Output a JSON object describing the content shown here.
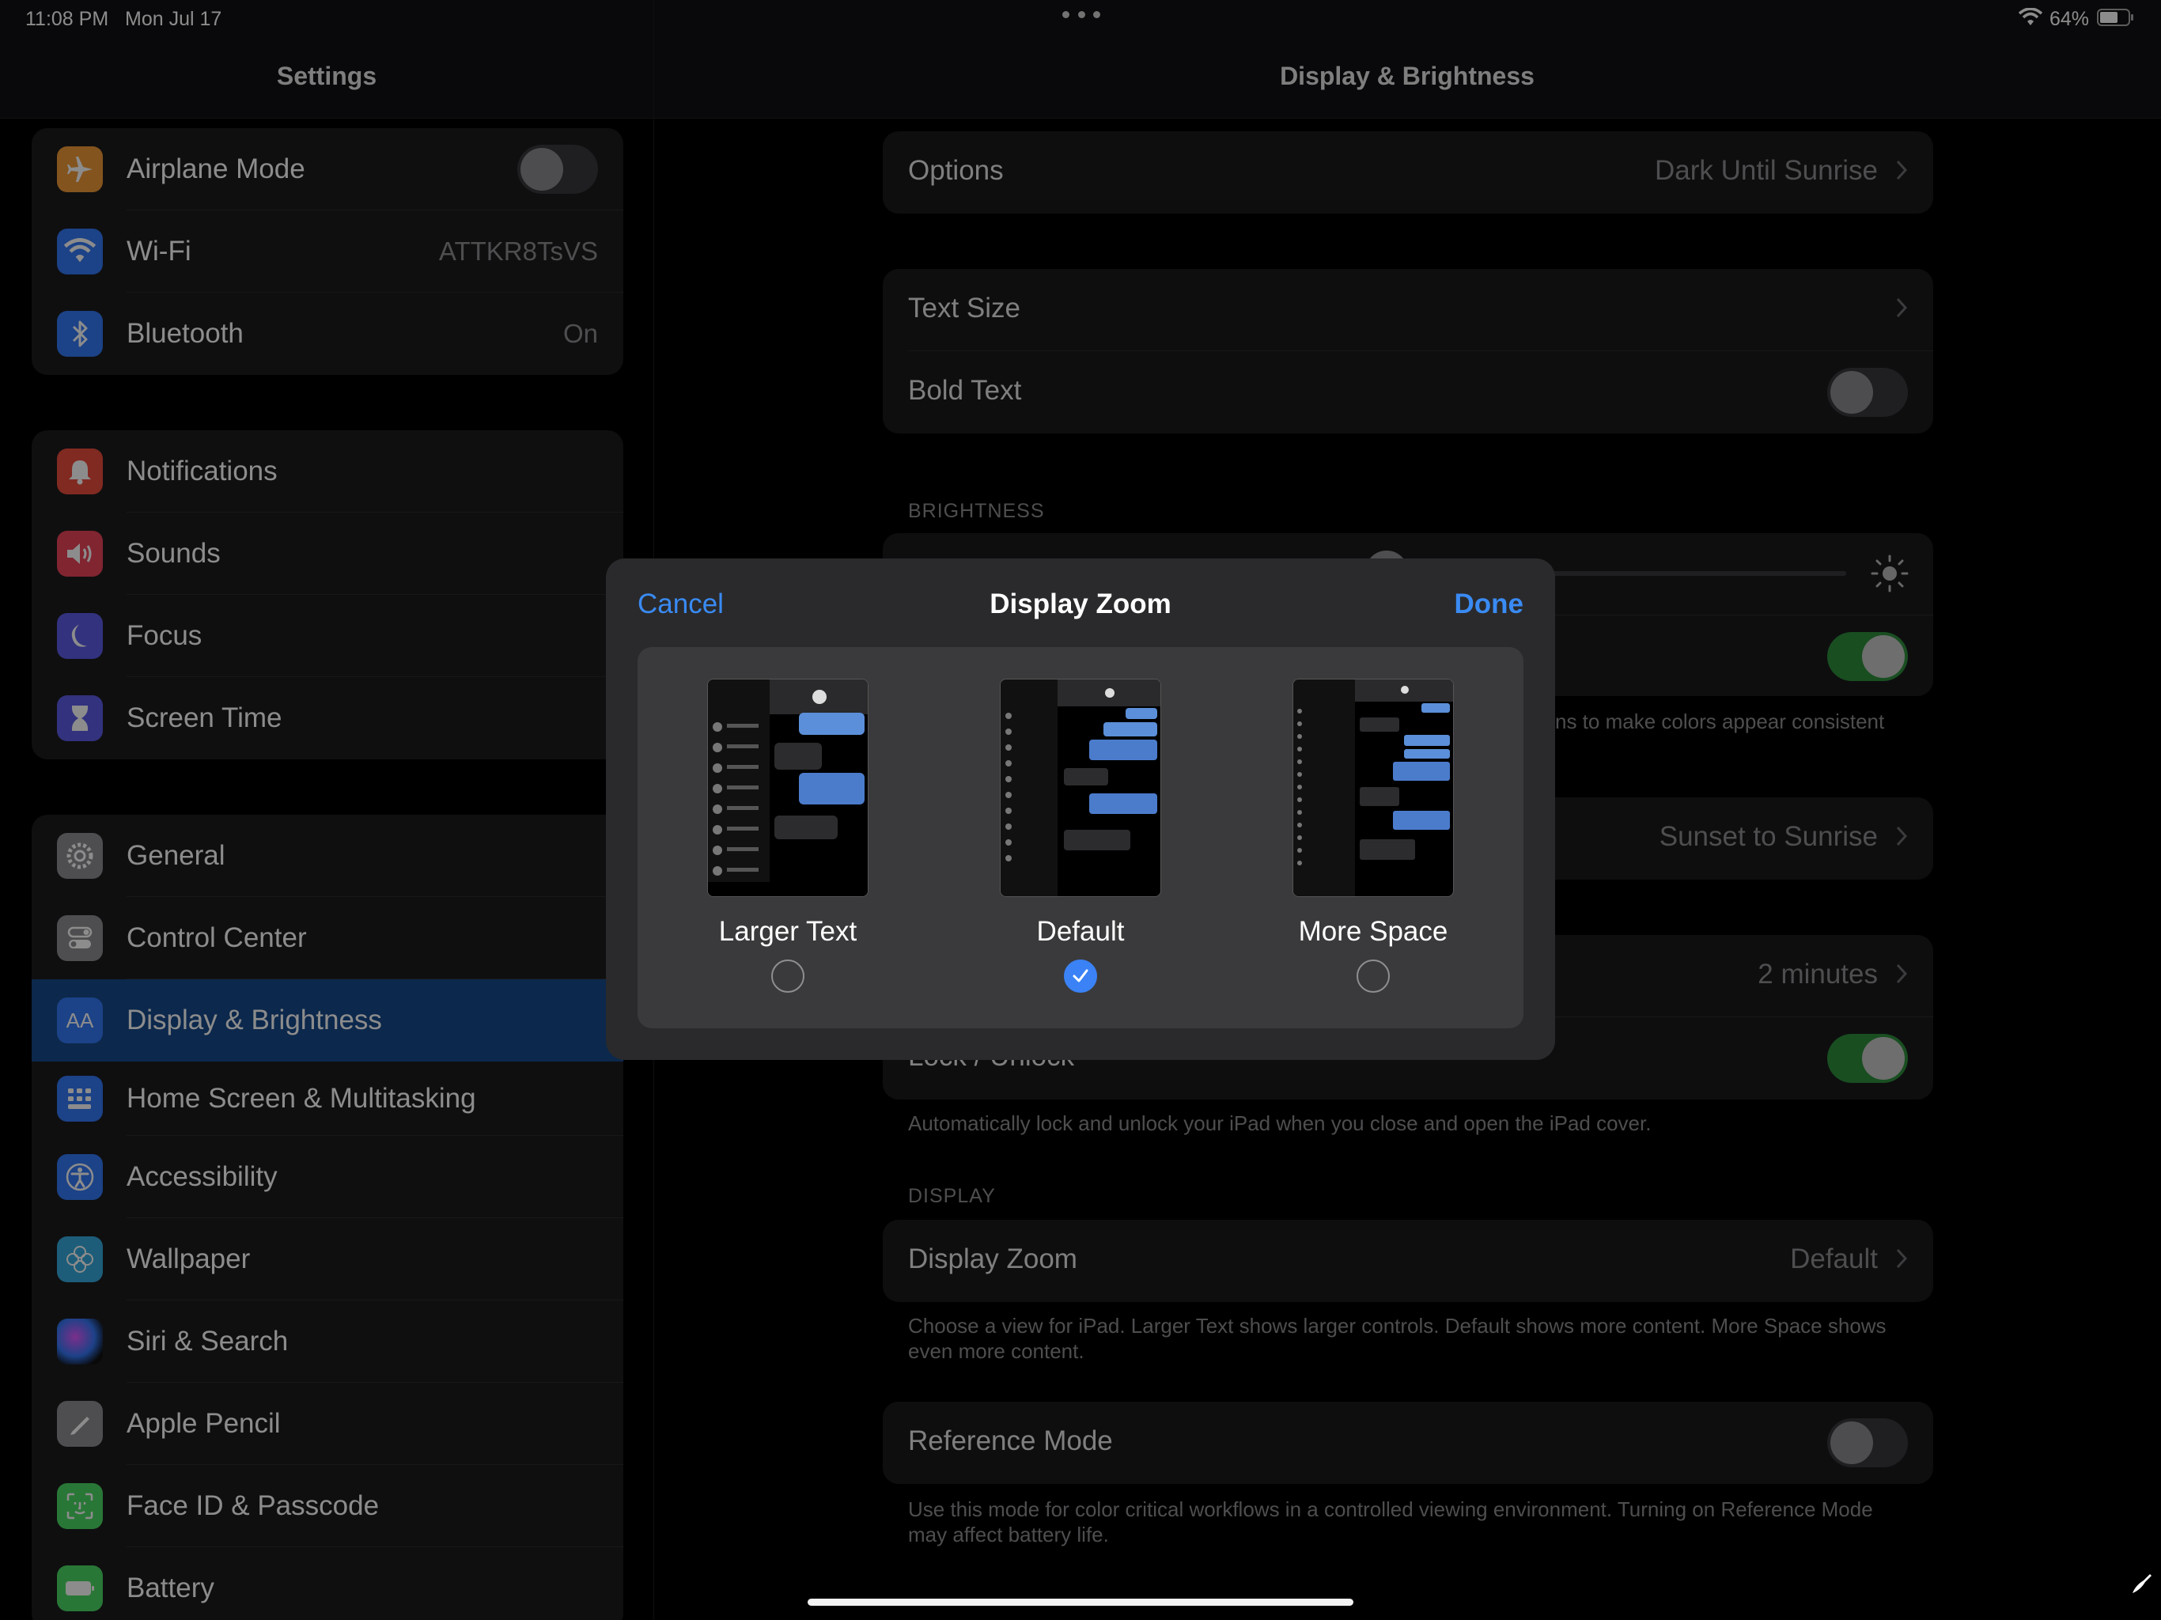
{
  "status": {
    "time": "11:08 PM",
    "date": "Mon Jul 17",
    "battery": "64%"
  },
  "sidebar": {
    "title": "Settings",
    "groups": [
      [
        {
          "label": "Airplane Mode",
          "icon": "airplane-icon",
          "color": "#f09a37",
          "toggle": "off"
        },
        {
          "label": "Wi-Fi",
          "icon": "wifi-icon",
          "color": "#3478f6",
          "value": "ATTKR8TsVS"
        },
        {
          "label": "Bluetooth",
          "icon": "bluetooth-icon",
          "color": "#3478f6",
          "value": "On"
        }
      ],
      [
        {
          "label": "Notifications",
          "icon": "bell-icon",
          "color": "#eb4d3d"
        },
        {
          "label": "Sounds",
          "icon": "speaker-icon",
          "color": "#eb445a"
        },
        {
          "label": "Focus",
          "icon": "moon-icon",
          "color": "#5e5ce6"
        },
        {
          "label": "Screen Time",
          "icon": "hourglass-icon",
          "color": "#5e5ce6"
        }
      ],
      [
        {
          "label": "General",
          "icon": "gear-icon",
          "color": "#8e8e93"
        },
        {
          "label": "Control Center",
          "icon": "switches-icon",
          "color": "#8e8e93"
        },
        {
          "label": "Display & Brightness",
          "icon": "text-size-icon",
          "color": "#3478f6",
          "selected": true
        },
        {
          "label": "Home Screen & Multitasking",
          "icon": "home-grid-icon",
          "color": "#3478f6"
        },
        {
          "label": "Accessibility",
          "icon": "accessibility-icon",
          "color": "#3478f6"
        },
        {
          "label": "Wallpaper",
          "icon": "flower-icon",
          "color": "#35aadc"
        },
        {
          "label": "Siri & Search",
          "icon": "siri-icon",
          "color": "#333"
        },
        {
          "label": "Apple Pencil",
          "icon": "pencil-icon",
          "color": "#8e8e93"
        },
        {
          "label": "Face ID & Passcode",
          "icon": "face-id-icon",
          "color": "#4cd964"
        },
        {
          "label": "Battery",
          "icon": "battery-icon",
          "color": "#4cd964"
        }
      ]
    ]
  },
  "detail": {
    "title": "Display & Brightness",
    "options_label": "Options",
    "options_value": "Dark Until Sunrise",
    "text_size": "Text Size",
    "bold_text": "Bold Text",
    "brightness_header": "BRIGHTNESS",
    "true_tone_footer_fragment": "ns to make colors appear consistent",
    "night_shift_value": "Sunset to Sunrise",
    "auto_lock_value": "2 minutes",
    "lock_unlock_label": "Lock / Unlock",
    "lock_footer": "Automatically lock and unlock your iPad when you close and open the iPad cover.",
    "display_header": "DISPLAY",
    "display_zoom_label": "Display Zoom",
    "display_zoom_value": "Default",
    "display_zoom_footer": "Choose a view for iPad. Larger Text shows larger controls. Default shows more content. More Space shows even more content.",
    "reference_mode": "Reference Mode",
    "reference_footer": "Use this mode for color critical workflows in a controlled viewing environment. Turning on Reference Mode may affect battery life."
  },
  "modal": {
    "cancel": "Cancel",
    "title": "Display Zoom",
    "done": "Done",
    "options": [
      {
        "label": "Larger Text",
        "selected": false
      },
      {
        "label": "Default",
        "selected": true
      },
      {
        "label": "More Space",
        "selected": false
      }
    ]
  }
}
